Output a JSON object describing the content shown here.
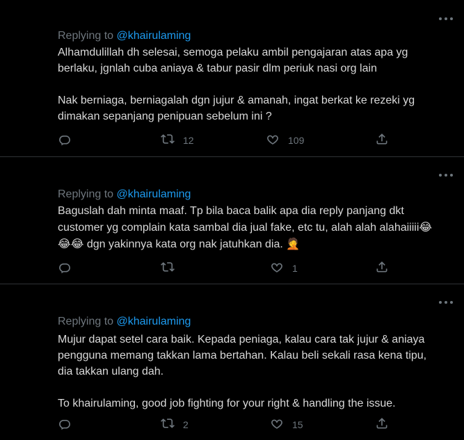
{
  "replies": [
    {
      "replying_prefix": "Replying to ",
      "handle": "@khairulaming",
      "lines": [
        "Alhamdulillah dh selesai, semoga pelaku ambil pengajaran atas apa yg",
        "berlaku, jgnlah cuba aniaya & tabur pasir dlm periuk nasi org lain",
        "Nak berniaga, berniagalah dgn jujur & amanah, ingat berkat ke rezeki yg",
        "dimakan sepanjang penipuan sebelum ini ?"
      ],
      "reply_count": "",
      "retweet_count": "12",
      "like_count": "109"
    },
    {
      "replying_prefix": "Replying to ",
      "handle": "@khairulaming",
      "lines": [
        "Baguslah dah minta maaf. Tp bila baca balik apa dia reply panjang dkt",
        "customer yg complain kata sambal dia jual fake, etc tu, alah alah alahaiiiii",
        "dgn yakinnya kata org nak jatuhkan dia."
      ],
      "emoji_laugh": "😂",
      "emoji_facepalm": "🤦",
      "reply_count": "",
      "retweet_count": "",
      "like_count": "1"
    },
    {
      "replying_prefix": "Replying to ",
      "handle": "@khairulaming",
      "lines": [
        "Mujur dapat setel cara baik. Kepada peniaga, kalau cara tak jujur & aniaya",
        "pengguna memang takkan lama bertahan. Kalau beli sekali rasa kena tipu,",
        "dia takkan ulang dah.",
        "To khairulaming, good job fighting for your right & handling the issue."
      ],
      "reply_count": "",
      "retweet_count": "2",
      "like_count": "15"
    }
  ],
  "icons": {
    "reply": "reply-icon",
    "retweet": "retweet-icon",
    "like": "like-icon",
    "share": "share-icon",
    "more": "more-icon"
  },
  "colors": {
    "background": "#000000",
    "text": "#d9d9d9",
    "muted": "#6e767d",
    "link": "#1d9bf0",
    "divider": "#2f3336"
  }
}
